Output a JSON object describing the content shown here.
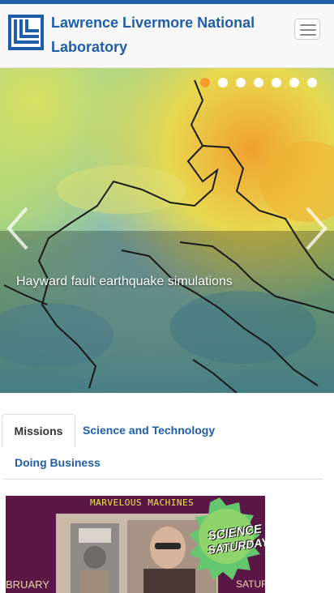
{
  "header": {
    "title": "Lawrence Livermore National Laboratory",
    "menu_icon": "hamburger-icon"
  },
  "colors": {
    "brand_blue": "#1f5ea8",
    "active_dot": "#f59b2b",
    "promo_bg": "#5b1745"
  },
  "carousel": {
    "caption": "Hayward fault earthquake simulations",
    "slide_count": 7,
    "active_index": 0,
    "prev_icon": "chevron-left-icon",
    "next_icon": "chevron-right-icon"
  },
  "tabs": [
    {
      "label": "Missions",
      "active": true
    },
    {
      "label": "Science and Technology",
      "active": false
    },
    {
      "label": "Doing Business",
      "active": false
    }
  ],
  "promo": {
    "heading": "MARVELOUS MACHINES",
    "badge_line1": "SCIENCE",
    "badge_line2": "SATURDAY",
    "left_text": "BRUARY",
    "right_text": "SATURD"
  }
}
